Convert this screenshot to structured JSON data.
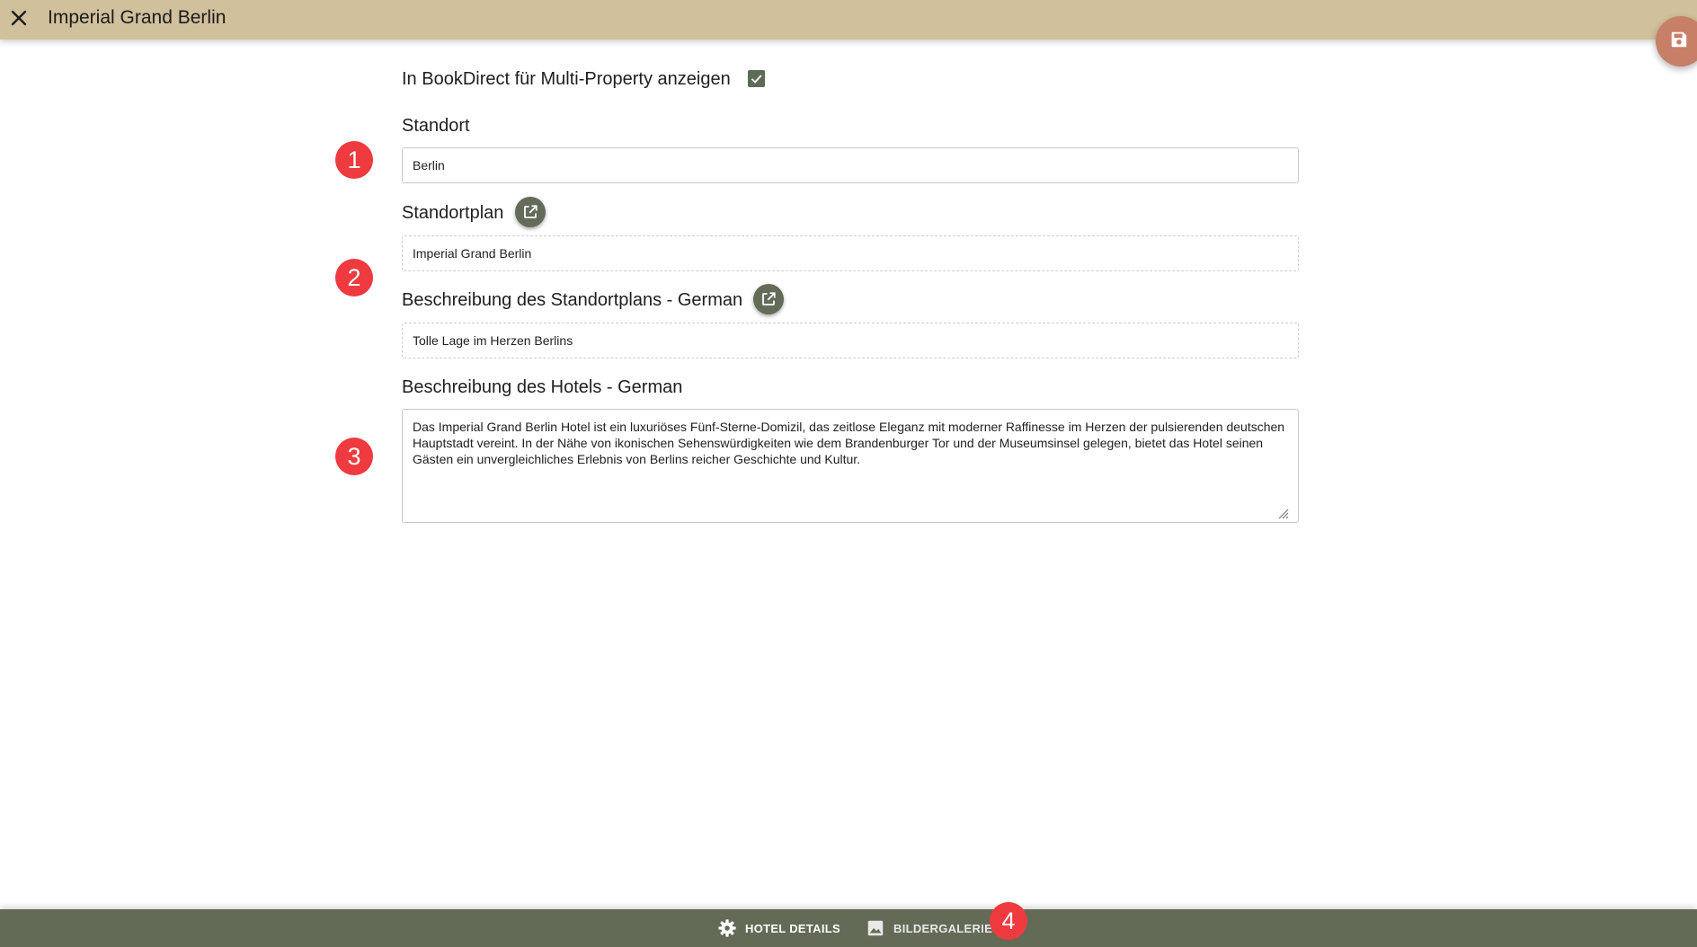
{
  "header": {
    "title": "Imperial Grand Berlin"
  },
  "form": {
    "multi_property_label": "In BookDirect für Multi-Property anzeigen",
    "multi_property_checked": true,
    "location_label": "Standort",
    "location_value": "Berlin",
    "location_plan_label": "Standortplan",
    "location_plan_value": "Imperial Grand Berlin",
    "location_plan_desc_label": "Beschreibung des Standortplans - German",
    "location_plan_desc_value": "Tolle Lage im Herzen Berlins",
    "hotel_desc_label": "Beschreibung des Hotels - German",
    "hotel_desc_value": "Das Imperial Grand Berlin Hotel ist ein luxuriöses Fünf-Sterne-Domizil, das zeitlose Eleganz mit moderner Raffinesse im Herzen der pulsierenden deutschen Hauptstadt vereint. In der Nähe von ikonischen Sehenswürdigkeiten wie dem Brandenburger Tor und der Museumsinsel gelegen, bietet das Hotel seinen Gästen ein unvergleichliches Erlebnis von Berlins reicher Geschichte und Kultur."
  },
  "markers": [
    "1",
    "2",
    "3",
    "4"
  ],
  "bottom_nav": {
    "tabs": [
      {
        "label": "HOTEL DETAILS",
        "icon": "gear-icon"
      },
      {
        "label": "BILDERGALERIE",
        "icon": "image-icon"
      }
    ]
  },
  "colors": {
    "header_bg": "#d1c09c",
    "save_fab": "#c87f67",
    "accent_green": "#636b56",
    "marker_red": "#ef3a3f"
  }
}
